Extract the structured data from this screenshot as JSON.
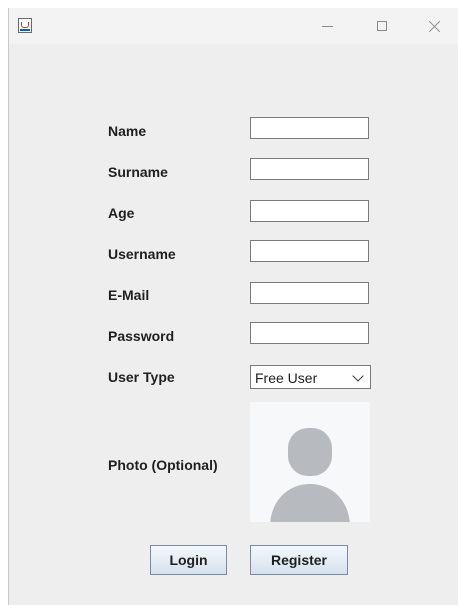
{
  "window": {
    "title": "",
    "controls": {
      "minimize": "minimize",
      "maximize": "maximize",
      "close": "close"
    }
  },
  "form": {
    "name_label": "Name",
    "surname_label": "Surname",
    "age_label": "Age",
    "username_label": "Username",
    "email_label": "E-Mail",
    "password_label": "Password",
    "user_type_label": "User Type",
    "user_type_value": "Free User",
    "photo_label": "Photo (Optional)",
    "name_value": "",
    "surname_value": "",
    "age_value": "",
    "username_value": "",
    "email_value": "",
    "password_value": ""
  },
  "buttons": {
    "login": "Login",
    "register": "Register"
  },
  "icons": {
    "app": "java-icon",
    "photo": "avatar-placeholder-icon",
    "dropdown": "chevron-down-icon"
  },
  "colors": {
    "window_bg": "#eeeeee",
    "button_top": "#f4f8fc",
    "button_bottom": "#d5e1ee",
    "avatar": "#b7babe"
  }
}
